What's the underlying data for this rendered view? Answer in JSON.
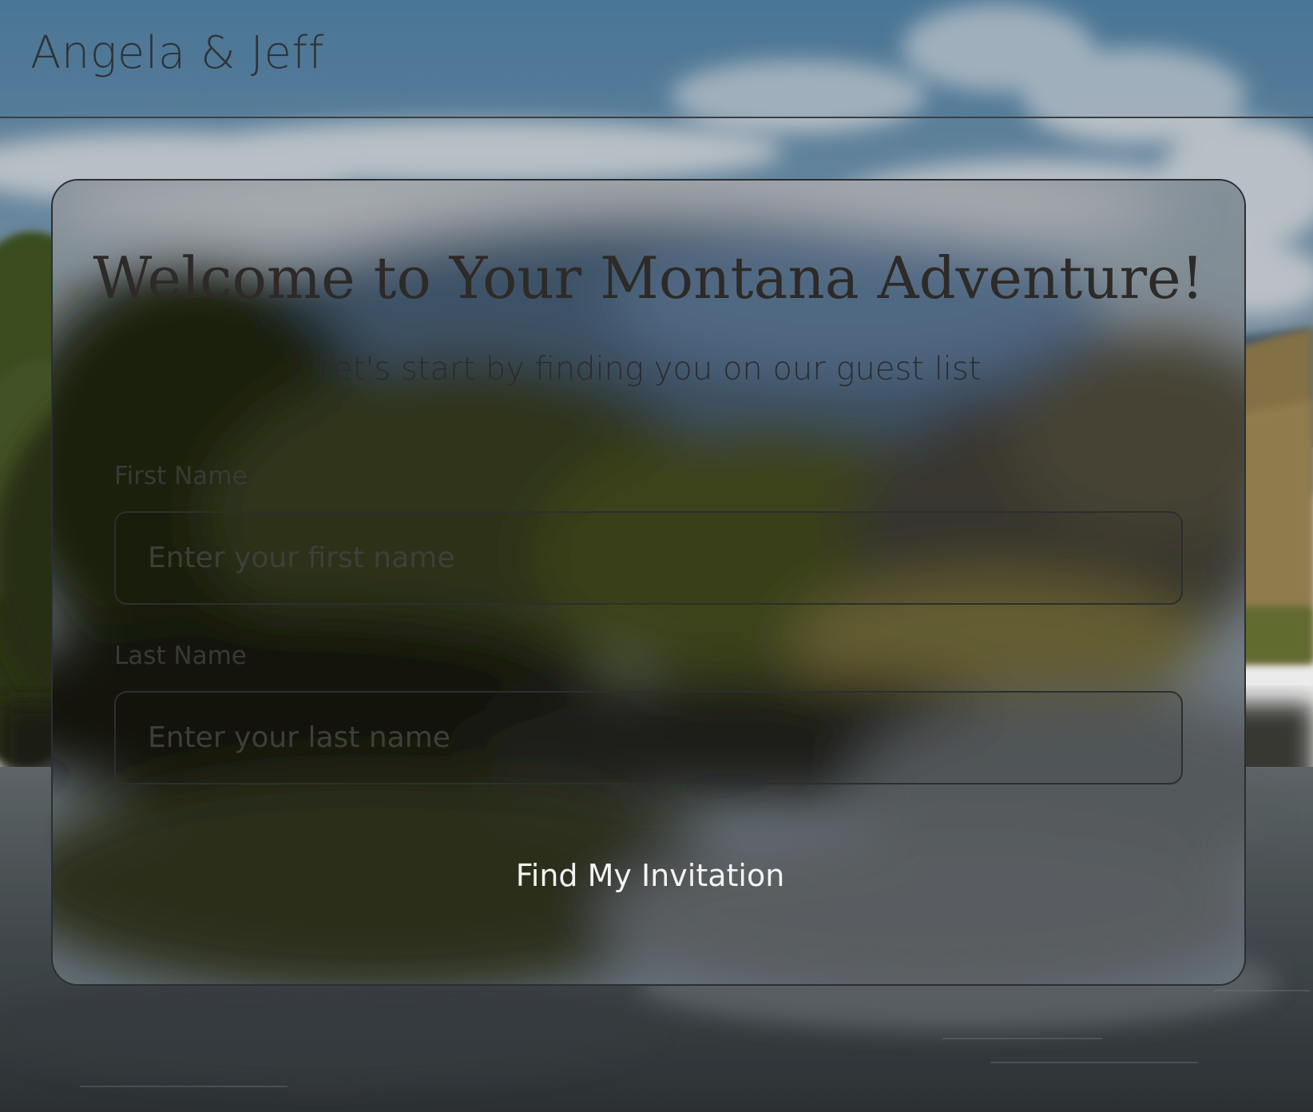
{
  "header": {
    "brand": "Angela & Jeff"
  },
  "card": {
    "title": "Welcome to Your Montana Adventure!",
    "subtitle": "Let's start by finding you on our guest list"
  },
  "form": {
    "first_name": {
      "label": "First Name",
      "placeholder": "Enter your first name",
      "value": ""
    },
    "last_name": {
      "label": "Last Name",
      "placeholder": "Enter your last name",
      "value": ""
    },
    "submit_label": "Find My Invitation"
  },
  "colors": {
    "sky": "#5d87a6",
    "water": "#4c565c",
    "foliage": "#3f4a1e",
    "text_dark": "#2f3338",
    "button_text": "#f4f4f2"
  }
}
